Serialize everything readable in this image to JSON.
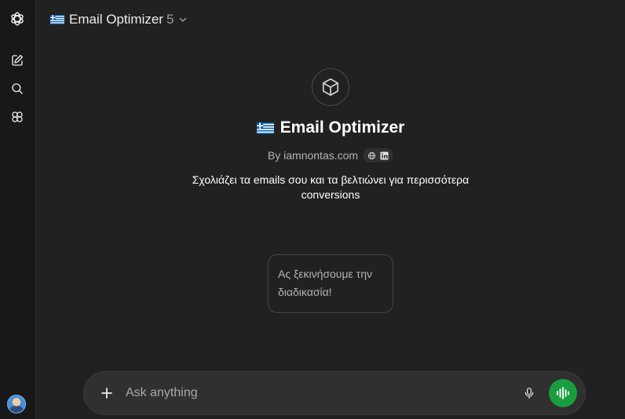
{
  "header": {
    "title": "Email Optimizer",
    "version": "5"
  },
  "gpt": {
    "name": "Email Optimizer",
    "author": "By iamnontas.com",
    "description": "Σχολιάζει τα emails σου και τα βελτιώνει για περισσότερα conversions"
  },
  "starters": [
    {
      "label": "Ας ξεκινήσουμε την διαδικασία!"
    }
  ],
  "composer": {
    "placeholder": "Ask anything"
  },
  "colors": {
    "background": "#212121",
    "sidebar": "#181818",
    "voice_button": "#1a9d3f"
  },
  "icons": {
    "sidebar": [
      "openai-logo-icon",
      "new-chat-icon",
      "search-icon",
      "gpts-icon"
    ],
    "flag": "greece-flag-icon",
    "gpt_avatar": "cube-icon",
    "links": [
      "globe-icon",
      "linkedin-icon"
    ],
    "composer": [
      "plus-icon",
      "microphone-icon",
      "voice-mode-icon"
    ]
  }
}
